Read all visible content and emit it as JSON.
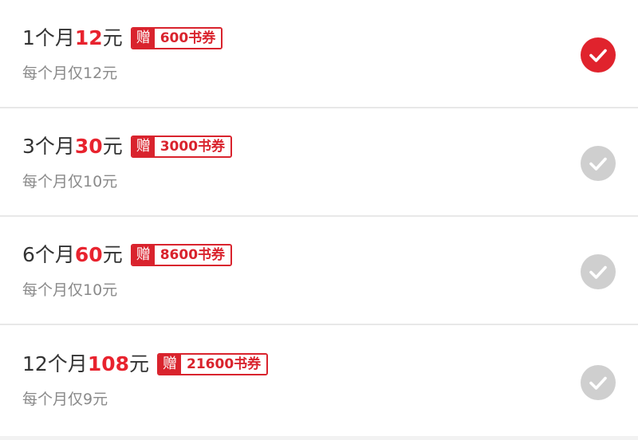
{
  "plans": [
    {
      "period": "1个月",
      "price": "12",
      "unit": "元",
      "gift_tag": "赠",
      "gift_amount": "600书券",
      "monthly": "每个月仅12元",
      "selected": true
    },
    {
      "period": "3个月",
      "price": "30",
      "unit": "元",
      "gift_tag": "赠",
      "gift_amount": "3000书券",
      "monthly": "每个月仅10元",
      "selected": false
    },
    {
      "period": "6个月",
      "price": "60",
      "unit": "元",
      "gift_tag": "赠",
      "gift_amount": "8600书券",
      "monthly": "每个月仅10元",
      "selected": false
    },
    {
      "period": "12个月",
      "price": "108",
      "unit": "元",
      "gift_tag": "赠",
      "gift_amount": "21600书券",
      "monthly": "每个月仅9元",
      "selected": false
    }
  ],
  "colors": {
    "accent": "#e8232e",
    "badge": "#d9232d",
    "check_selected": "#e0232d",
    "check_unselected": "#cfcfcf"
  },
  "icons": {
    "check": "checkmark-circle-icon"
  }
}
